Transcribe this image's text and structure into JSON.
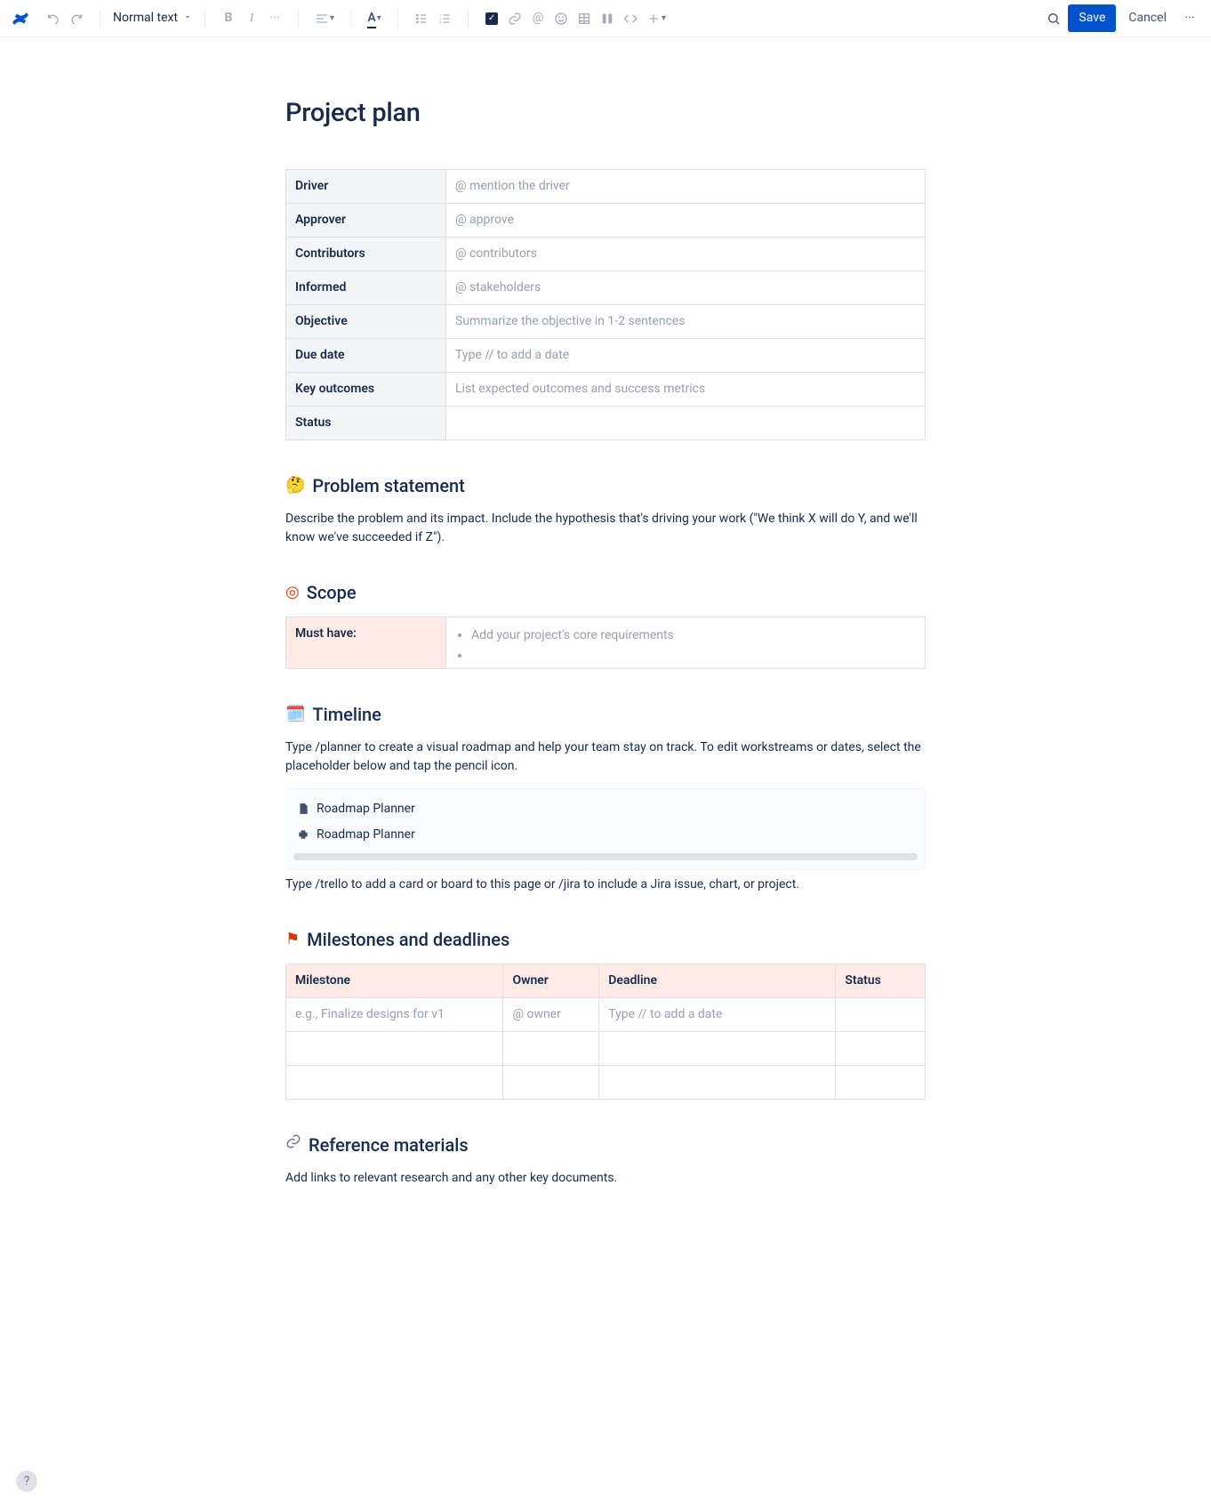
{
  "toolbar": {
    "style_label": "Normal text",
    "save_label": "Save",
    "cancel_label": "Cancel"
  },
  "page": {
    "title": "Project plan"
  },
  "meta": [
    {
      "label": "Driver",
      "value": "@ mention the driver",
      "placeholder": true
    },
    {
      "label": "Approver",
      "value": "@ approve",
      "placeholder": true
    },
    {
      "label": "Contributors",
      "value": "@ contributors",
      "placeholder": true
    },
    {
      "label": "Informed",
      "value": "@ stakeholders",
      "placeholder": true
    },
    {
      "label": "Objective",
      "value": "Summarize the objective in 1-2 sentences",
      "placeholder": true
    },
    {
      "label": "Due date",
      "value": "Type // to add a date",
      "placeholder": true
    },
    {
      "label": "Key outcomes",
      "value": "List expected outcomes and success metrics",
      "placeholder": true
    },
    {
      "label": "Status",
      "value": "",
      "placeholder": true
    }
  ],
  "sections": {
    "problem": {
      "emoji": "🤔",
      "title": "Problem statement",
      "body": "Describe the problem and its impact. Include the hypothesis that's driving your work (\"We think X will do Y, and we'll know we've succeeded if Z\")."
    },
    "scope": {
      "emoji": "🎯",
      "title": "Scope",
      "row_label": "Must have:",
      "item": "Add your project's core requirements"
    },
    "timeline": {
      "emoji": "🗓️",
      "title": "Timeline",
      "body1": "Type /planner to create a visual roadmap and help your team stay on track. To edit workstreams or dates, select the placeholder below and tap the pencil icon.",
      "macro1": "Roadmap Planner",
      "macro2": "Roadmap Planner",
      "body2": "Type /trello to add a card or board to this page or /jira to include a Jira issue, chart, or project."
    },
    "milestones": {
      "emoji": "🚩",
      "title": "Milestones and deadlines",
      "headers": {
        "c1": "Milestone",
        "c2": "Owner",
        "c3": "Deadline",
        "c4": "Status"
      },
      "row1": {
        "c1": "e.g., Finalize designs for v1",
        "c2": "@ owner",
        "c3": "Type // to add a date",
        "c4": ""
      }
    },
    "reference": {
      "emoji": "🔗",
      "title": "Reference materials",
      "body": "Add links to relevant research and any other key documents."
    }
  }
}
